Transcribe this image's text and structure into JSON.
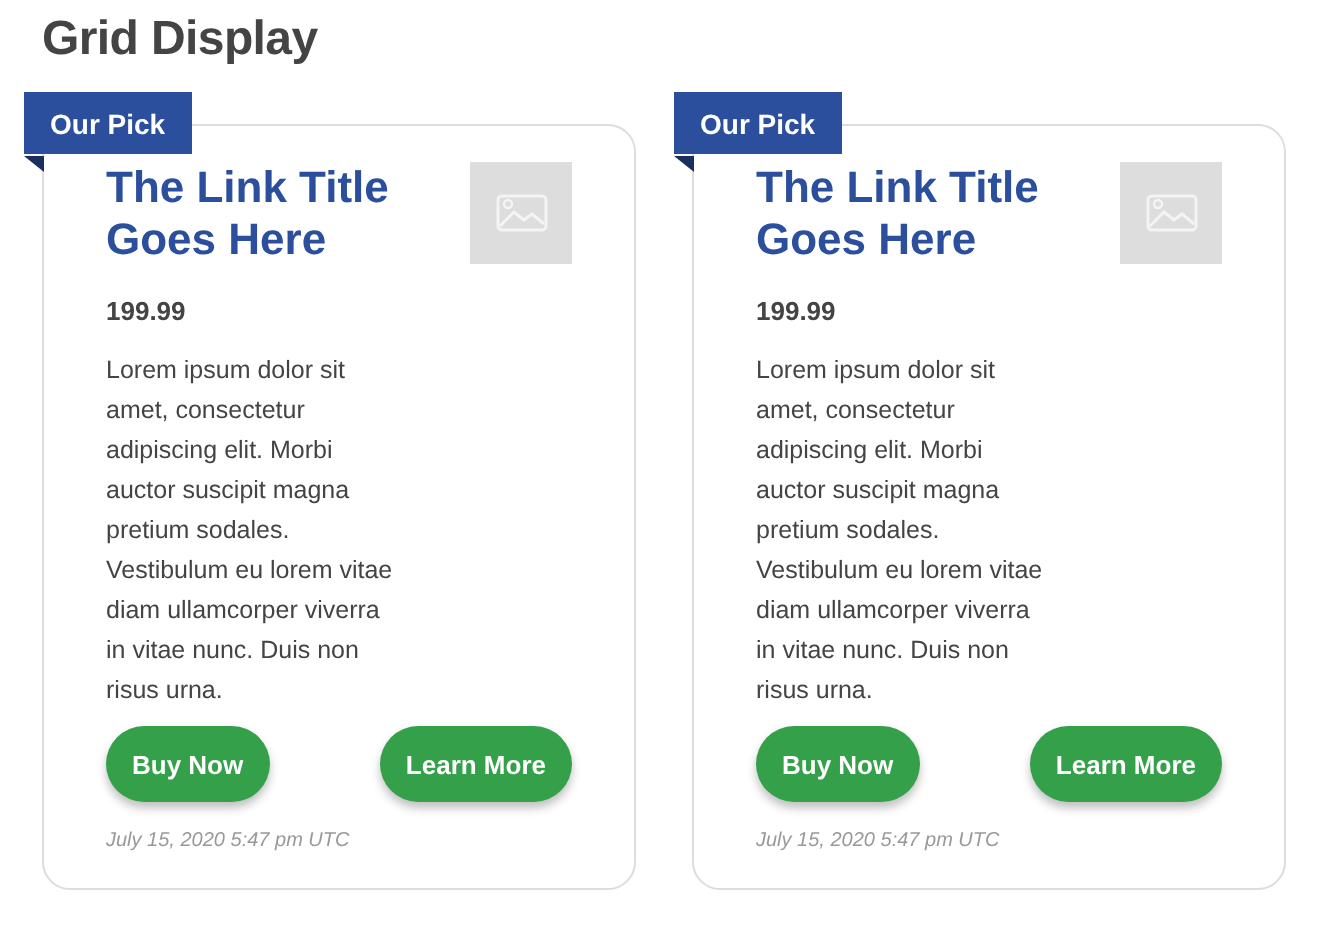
{
  "heading": "Grid Display",
  "cards": [
    {
      "badge": "Our Pick",
      "title": "The Link Title Goes Here",
      "price": "199.99",
      "description": "Lorem ipsum dolor sit amet, consectetur adipiscing elit. Morbi auctor suscipit magna pretium sodales. Vestibulum eu lorem vitae diam ullamcorper viverra in vitae nunc. Duis non risus urna.",
      "buttons": [
        "Buy Now",
        "Learn More"
      ],
      "date": "July 15, 2020 5:47 pm UTC"
    },
    {
      "badge": "Our Pick",
      "title": "The Link Title Goes Here",
      "price": "199.99",
      "description": "Lorem ipsum dolor sit amet, consectetur adipiscing elit. Morbi auctor suscipit magna pretium sodales. Vestibulum eu lorem vitae diam ullamcorper viverra in vitae nunc. Duis non risus urna.",
      "buttons": [
        "Buy Now",
        "Learn More"
      ],
      "date": "July 15, 2020 5:47 pm UTC"
    }
  ]
}
